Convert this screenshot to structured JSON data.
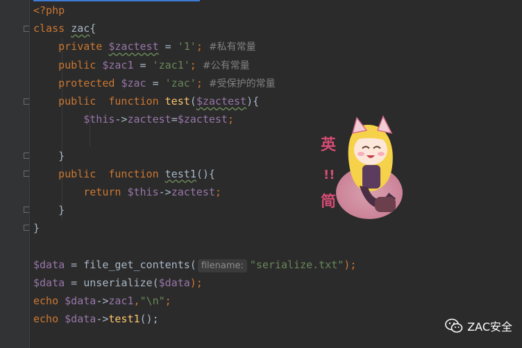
{
  "editor": {
    "lines": [
      [
        {
          "t": "<?php",
          "c": "kw"
        }
      ],
      [
        {
          "t": "class ",
          "c": "kw"
        },
        {
          "t": "zac",
          "c": "plain wavy"
        },
        {
          "t": "{",
          "c": "plain"
        }
      ],
      [
        {
          "t": "    private ",
          "c": "kw"
        },
        {
          "t": "$zactest",
          "c": "var wavy"
        },
        {
          "t": " = ",
          "c": "plain"
        },
        {
          "t": "'1'",
          "c": "str"
        },
        {
          "t": "; ",
          "c": "kw"
        },
        {
          "t": "#私有常量",
          "c": "cmt"
        }
      ],
      [
        {
          "t": "    public ",
          "c": "kw"
        },
        {
          "t": "$zac1",
          "c": "var"
        },
        {
          "t": " = ",
          "c": "plain"
        },
        {
          "t": "'zac1'",
          "c": "str"
        },
        {
          "t": "; ",
          "c": "kw"
        },
        {
          "t": "#公有常量",
          "c": "cmt"
        }
      ],
      [
        {
          "t": "    protected ",
          "c": "kw"
        },
        {
          "t": "$zac",
          "c": "var"
        },
        {
          "t": " = ",
          "c": "plain"
        },
        {
          "t": "'zac'",
          "c": "str"
        },
        {
          "t": "; ",
          "c": "kw"
        },
        {
          "t": "#受保护的常量",
          "c": "cmt"
        }
      ],
      [
        {
          "t": "    public  function ",
          "c": "kw"
        },
        {
          "t": "test",
          "c": "fn"
        },
        {
          "t": "(",
          "c": "plain"
        },
        {
          "t": "$zactest",
          "c": "var wavy"
        },
        {
          "t": "){",
          "c": "plain"
        }
      ],
      [
        {
          "t": "        ",
          "c": "plain"
        },
        {
          "t": "$this",
          "c": "var"
        },
        {
          "t": "->",
          "c": "plain"
        },
        {
          "t": "zactest",
          "c": "var"
        },
        {
          "t": "=",
          "c": "plain"
        },
        {
          "t": "$zactest",
          "c": "var"
        },
        {
          "t": ";",
          "c": "kw"
        }
      ],
      [
        {
          "t": "",
          "c": "plain"
        }
      ],
      [
        {
          "t": "    }",
          "c": "plain"
        }
      ],
      [
        {
          "t": "    public  function ",
          "c": "kw"
        },
        {
          "t": "test1",
          "c": "plain wavy"
        },
        {
          "t": "(){",
          "c": "plain"
        }
      ],
      [
        {
          "t": "        return ",
          "c": "kw"
        },
        {
          "t": "$this",
          "c": "var"
        },
        {
          "t": "->",
          "c": "plain"
        },
        {
          "t": "zactest",
          "c": "var"
        },
        {
          "t": ";",
          "c": "kw"
        }
      ],
      [
        {
          "t": "    }",
          "c": "plain"
        }
      ],
      [
        {
          "t": "}",
          "c": "plain"
        }
      ],
      [
        {
          "t": "",
          "c": "plain"
        }
      ],
      [
        {
          "t": "$data",
          "c": "var"
        },
        {
          "t": " = ",
          "c": "plain"
        },
        {
          "t": "file_get_contents",
          "c": "plain"
        },
        {
          "t": "(",
          "c": "plain"
        },
        {
          "hint": "filename:"
        },
        {
          "t": "\"serialize.txt\"",
          "c": "str"
        },
        {
          "t": ");",
          "c": "kw"
        }
      ],
      [
        {
          "t": "$data",
          "c": "var"
        },
        {
          "t": " = ",
          "c": "plain"
        },
        {
          "t": "unserialize",
          "c": "plain"
        },
        {
          "t": "(",
          "c": "plain"
        },
        {
          "t": "$data",
          "c": "var"
        },
        {
          "t": ");",
          "c": "kw"
        }
      ],
      [
        {
          "t": "echo ",
          "c": "kw"
        },
        {
          "t": "$data",
          "c": "var"
        },
        {
          "t": "->",
          "c": "plain"
        },
        {
          "t": "zac1",
          "c": "var"
        },
        {
          "t": ",",
          "c": "kw"
        },
        {
          "t": "\"\\n\"",
          "c": "str"
        },
        {
          "t": ";",
          "c": "kw"
        }
      ],
      [
        {
          "t": "echo ",
          "c": "kw"
        },
        {
          "t": "$data",
          "c": "var"
        },
        {
          "t": "->",
          "c": "plain"
        },
        {
          "t": "test1",
          "c": "fn"
        },
        {
          "t": "();",
          "c": "plain"
        }
      ]
    ]
  },
  "sticker": {
    "text_top": "英",
    "text_mid": "!!",
    "text_bottom": "简"
  },
  "watermark": {
    "label": "ZAC安全",
    "icon": "wechat-icon"
  },
  "colors": {
    "background": "#2b2b2b",
    "gutter": "#313335",
    "keyword": "#cc7832",
    "variable": "#9876aa",
    "string": "#6a8759",
    "comment": "#808080",
    "function": "#ffc66d",
    "plain": "#a9b7c6",
    "accent": "#3d7dd8"
  }
}
